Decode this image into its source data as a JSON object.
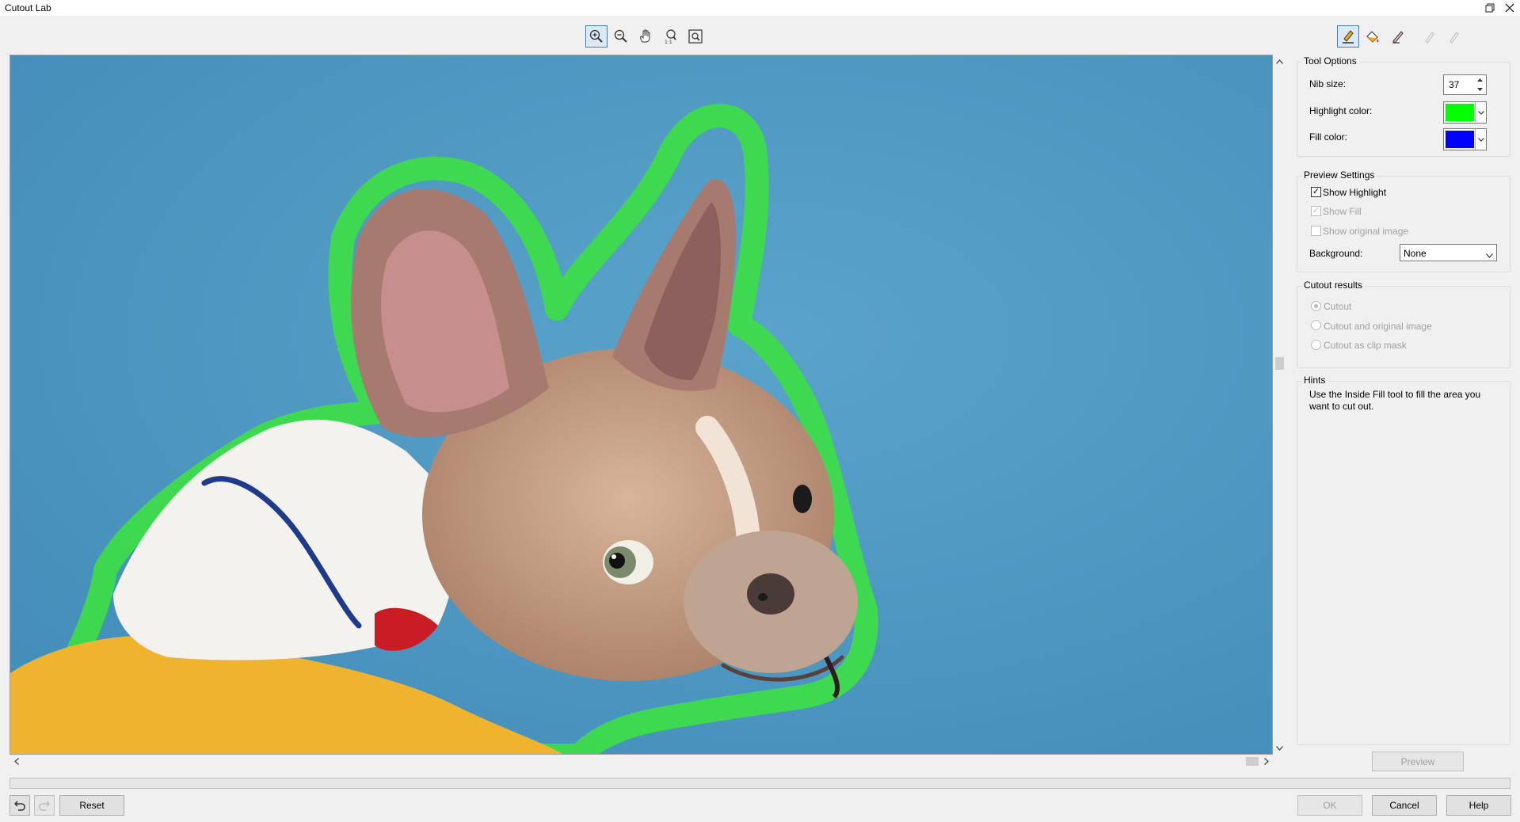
{
  "window": {
    "title": "Cutout Lab"
  },
  "toolbar_left": [
    {
      "icon": "zoom-in-icon",
      "active": true
    },
    {
      "icon": "zoom-out-icon",
      "active": false
    },
    {
      "icon": "hand-pan-icon",
      "active": false
    },
    {
      "icon": "zoom-one-to-one-icon",
      "active": false
    },
    {
      "icon": "zoom-to-fit-icon",
      "active": false
    }
  ],
  "toolbar_right": [
    {
      "icon": "highlighter-icon",
      "active": true
    },
    {
      "icon": "inside-fill-icon",
      "active": false
    },
    {
      "icon": "eraser-icon",
      "active": false
    },
    {
      "icon": "add-detail-icon",
      "active": false,
      "disabled": true
    },
    {
      "icon": "remove-detail-icon",
      "active": false,
      "disabled": true
    }
  ],
  "tool_options": {
    "title": "Tool Options",
    "nib_size_label": "Nib size:",
    "nib_size_value": "37",
    "highlight_color_label": "Highlight color:",
    "highlight_color": "#00ff00",
    "fill_color_label": "Fill color:",
    "fill_color": "#0000ff"
  },
  "preview_settings": {
    "title": "Preview Settings",
    "show_highlight": "Show Highlight",
    "show_fill": "Show Fill",
    "show_original": "Show original image",
    "background_label": "Background:",
    "background_value": "None"
  },
  "cutout_results": {
    "title": "Cutout results",
    "option_cutout": "Cutout",
    "option_cutout_original": "Cutout and original image",
    "option_clip_mask": "Cutout as clip mask"
  },
  "hints": {
    "title": "Hints",
    "text": "Use the Inside Fill tool to fill the area you want to cut out."
  },
  "buttons": {
    "preview": "Preview",
    "reset": "Reset",
    "ok": "OK",
    "cancel": "Cancel",
    "help": "Help"
  },
  "colors": {
    "canvas_background": "#4a93bd",
    "highlight": "#3ddc4a",
    "hoodie_yellow": "#f0b32e",
    "accent": "#3c7fb1"
  }
}
